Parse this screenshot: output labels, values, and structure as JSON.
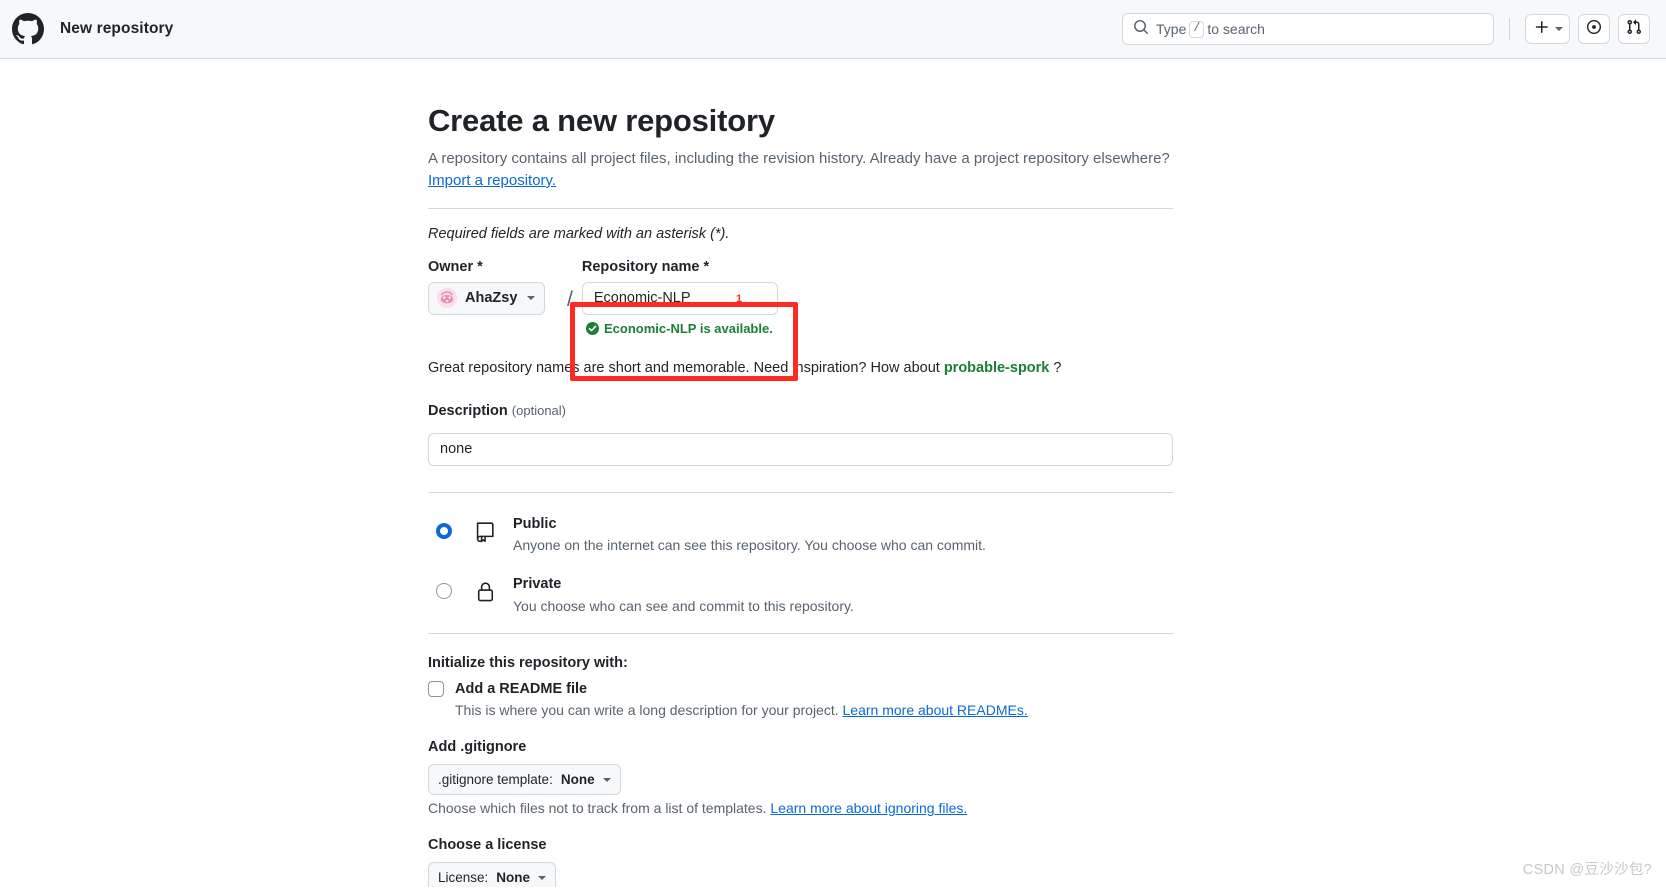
{
  "header": {
    "logo_icon": "github-mark-icon",
    "title": "New repository",
    "search": {
      "icon": "search-icon",
      "placeholder_prefix": "Type",
      "kbd": "/",
      "placeholder_suffix": "to search"
    },
    "actions": [
      {
        "name": "create-new-menu",
        "icon": "plus-icon",
        "caret": true
      },
      {
        "name": "issues-button",
        "icon": "issue-opened-icon",
        "caret": false
      },
      {
        "name": "pull-requests-button",
        "icon": "git-pull-request-icon",
        "caret": false
      }
    ]
  },
  "main": {
    "title": "Create a new repository",
    "subtitle": "A repository contains all project files, including the revision history. Already have a project repository elsewhere?",
    "import_link": "Import a repository.",
    "required_note": "Required fields are marked with an asterisk (*).",
    "owner": {
      "label": "Owner *",
      "value": "AhaZsy",
      "avatar_color": "#f6d4e0"
    },
    "separator": "/",
    "repo_name": {
      "label": "Repository name *",
      "value": "Economic-NLP",
      "availability": "Economic-NLP is available.",
      "availability_color": "#1a7f37"
    },
    "inspiration": {
      "prefix": "Great repository names are short and memorable. Need inspiration? How about",
      "suggestion": "probable-spork",
      "suffix": "?"
    },
    "description": {
      "label": "Description",
      "optional": "(optional)",
      "value": "none"
    },
    "visibility": [
      {
        "id": "public",
        "icon": "repo-icon",
        "title": "Public",
        "description": "Anyone on the internet can see this repository. You choose who can commit.",
        "selected": true
      },
      {
        "id": "private",
        "icon": "lock-icon",
        "title": "Private",
        "description": "You choose who can see and commit to this repository.",
        "selected": false
      }
    ],
    "initialize": {
      "heading": "Initialize this repository with:",
      "readme": {
        "label": "Add a README file",
        "checked": false,
        "note_prefix": "This is where you can write a long description for your project.",
        "note_link": "Learn more about READMEs."
      }
    },
    "gitignore": {
      "heading": "Add .gitignore",
      "select_prefix": ".gitignore template:",
      "select_value": "None",
      "note_prefix": "Choose which files not to track from a list of templates.",
      "note_link": "Learn more about ignoring files."
    },
    "license": {
      "heading": "Choose a license",
      "select_prefix": "License:",
      "select_value": "None"
    }
  },
  "annotation": {
    "number": "1",
    "color": "#ff2a21"
  },
  "watermark": "CSDN @豆沙沙包?"
}
